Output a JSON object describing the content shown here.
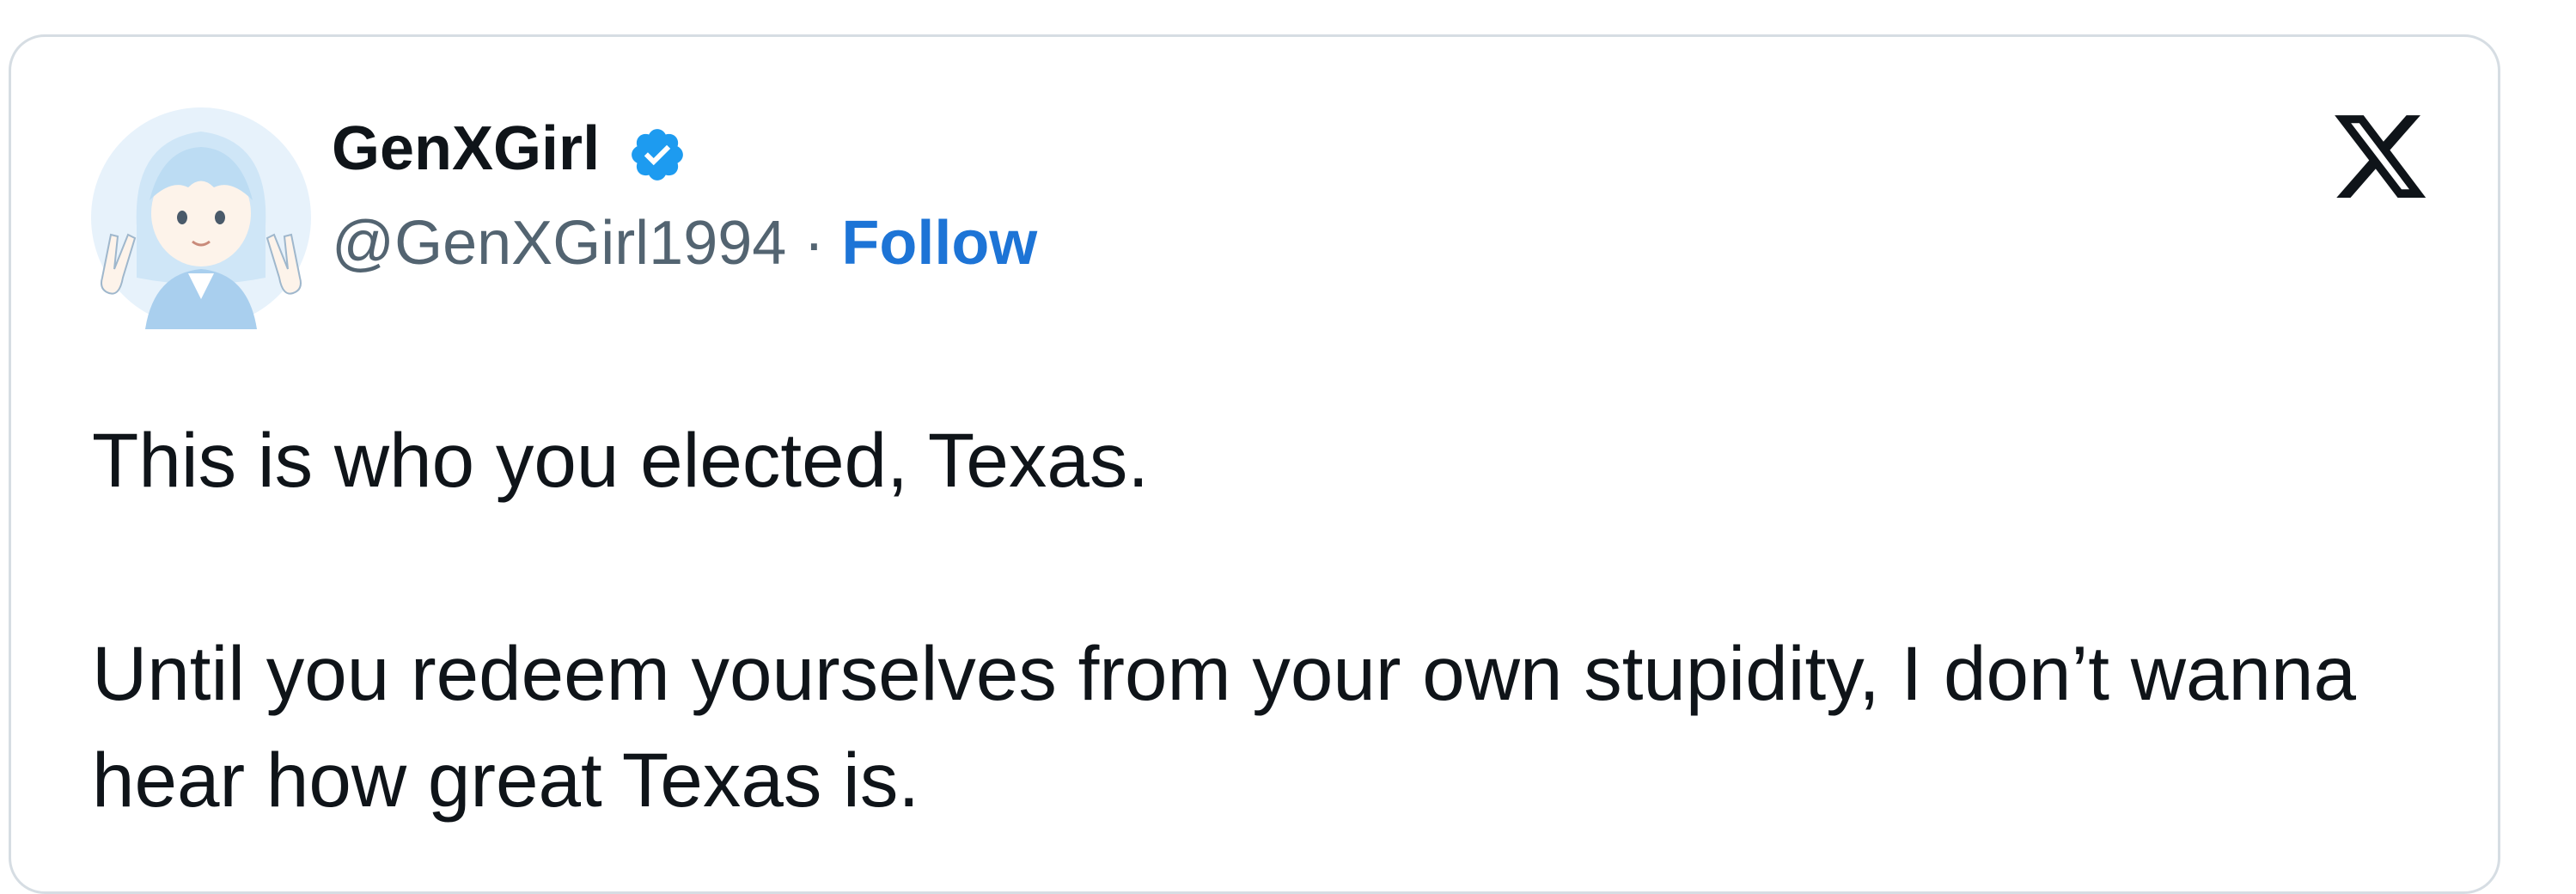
{
  "tweet": {
    "author": {
      "display_name": "GenXGirl",
      "handle": "@GenXGirl1994",
      "verified": true,
      "avatar_icon": "anime-avatar"
    },
    "separator": "·",
    "follow_label": "Follow",
    "platform_icon": "x-logo-icon",
    "text_paragraphs": [
      "This is who you elected, Texas.",
      "Until you redeem yourselves from your own stupidity, I don’t wanna hear how great Texas is."
    ]
  },
  "colors": {
    "follow": "#1d74d6",
    "verified_badge": "#1d9bf0",
    "handle": "#536471",
    "border": "#d6dde3"
  }
}
